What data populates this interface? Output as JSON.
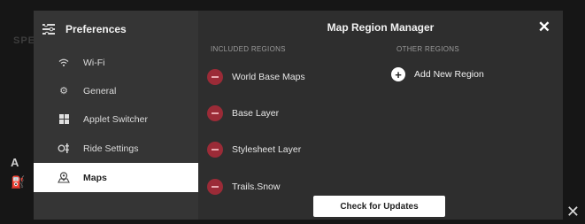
{
  "background": {
    "partial_text": "SPE",
    "side_icons": [
      "A",
      "⛽"
    ],
    "close_symbol": "✕"
  },
  "sidebar": {
    "title": "Preferences",
    "items": [
      {
        "label": "Wi-Fi",
        "icon": "wifi-icon",
        "active": false
      },
      {
        "label": "General",
        "icon": "gear-icon",
        "active": false
      },
      {
        "label": "Applet Switcher",
        "icon": "grid-icon",
        "active": false
      },
      {
        "label": "Ride Settings",
        "icon": "ride-settings-icon",
        "active": false
      },
      {
        "label": "Maps",
        "icon": "map-icon",
        "active": true
      }
    ]
  },
  "dialog": {
    "title": "Map Region Manager",
    "close_symbol": "✕",
    "included_header": "INCLUDED REGIONS",
    "other_header": "OTHER REGIONS",
    "included_regions": [
      "World Base Maps",
      "Base Layer",
      "Stylesheet Layer",
      "Trails.Snow"
    ],
    "add_label": "Add New Region",
    "update_label": "Check for Updates"
  },
  "colors": {
    "remove_button": "#9b2b37",
    "sidebar_bg": "#353535",
    "panel_bg": "#2e2e2e",
    "active_item_bg": "#ffffff"
  }
}
